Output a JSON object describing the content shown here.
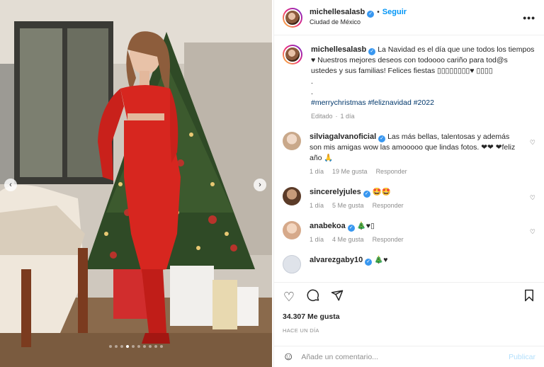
{
  "post": {
    "username": "michellesalasb",
    "follow_label": "Seguir",
    "separator": "•",
    "location": "Ciudad de México",
    "more_icon": "more-options-icon"
  },
  "caption": {
    "username": "michellesalasb",
    "text": "La Navidad es el día que une todos los tiempos ♥ Nuestros mejores deseos con todoooo cariño para tod@s ustedes y sus familias! Felices fiestas ▯▯▯▯▯▯▯▯♥ ▯▯▯▯",
    "dot1": ".",
    "dot2": ".",
    "hashtags": "#merrychristmas #feliznavidad #2022",
    "edited": "Editado",
    "time": "1 día"
  },
  "comments": [
    {
      "username": "silviagalvanoficial",
      "verified": true,
      "text": "Las más bellas, talentosas y además son mis amigas wow las amooooo que lindas fotos. ❤❤ ❤feliz año 🙏",
      "time": "1 día",
      "likes": "19 Me gusta",
      "reply": "Responder"
    },
    {
      "username": "sincerelyjules",
      "verified": true,
      "text": "🤩🤩",
      "time": "1 día",
      "likes": "5 Me gusta",
      "reply": "Responder"
    },
    {
      "username": "anabekoa",
      "verified": true,
      "text": "🎄♥▯",
      "time": "1 día",
      "likes": "4 Me gusta",
      "reply": "Responder"
    },
    {
      "username": "alvarezgaby10",
      "verified": true,
      "text": "🎄♥",
      "time": "",
      "likes": "",
      "reply": ""
    }
  ],
  "actions": {
    "like_icon": "heart-icon",
    "comment_icon": "comment-icon",
    "share_icon": "share-icon",
    "save_icon": "bookmark-icon"
  },
  "likes": "34.307 Me gusta",
  "time_ago": "HACE UN DÍA",
  "composer": {
    "placeholder": "Añade un comentario...",
    "publish_label": "Publicar"
  },
  "carousel": {
    "total_slides": 10,
    "active_slide": 4
  },
  "colors": {
    "accent": "#0095f6",
    "dress": "#d7261f",
    "link": "#00376b"
  }
}
